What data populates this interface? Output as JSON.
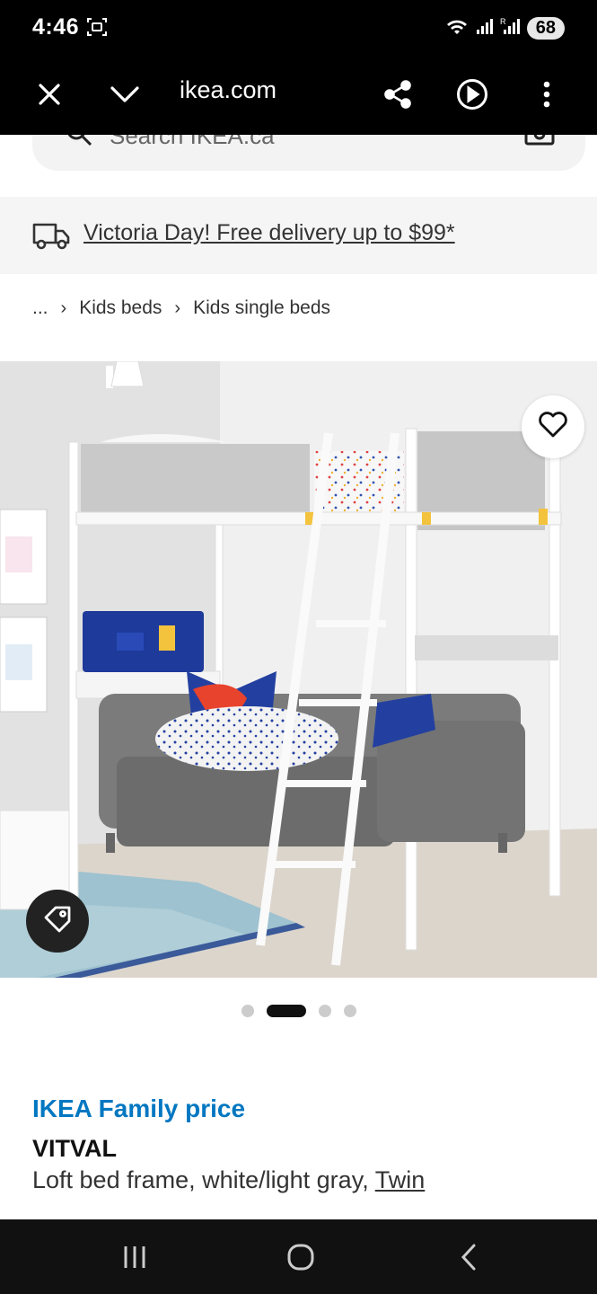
{
  "status_bar": {
    "time": "4:46",
    "battery": "68",
    "icons": [
      "screenshot-icon",
      "wifi-icon",
      "signal-icon",
      "signal-roaming-icon"
    ]
  },
  "browser": {
    "url": "ikea.com",
    "icons": [
      "close-icon",
      "chevron-down-icon",
      "share-icon",
      "play-icon",
      "more-vert-icon"
    ]
  },
  "search": {
    "placeholder": "Search IKEA.ca"
  },
  "promo": {
    "text": "Victoria Day! Free delivery up to $99*"
  },
  "breadcrumb": {
    "items": [
      "...",
      "Kids beds",
      "Kids single beds"
    ]
  },
  "gallery": {
    "slide_count": 4,
    "active_index": 1
  },
  "product": {
    "price_label": "IKEA Family price",
    "name": "VITVAL",
    "description": "Loft bed frame, white/light gray, ",
    "size": "Twin"
  },
  "colors": {
    "family_blue": "#0077c1",
    "status_bg": "#000000",
    "promo_bg": "#f5f5f5"
  }
}
